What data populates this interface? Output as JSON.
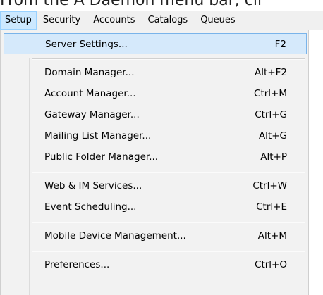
{
  "caption": "From the A Daemon menu bar, cli",
  "menubar": {
    "items": [
      "Setup",
      "Security",
      "Accounts",
      "Catalogs",
      "Queues"
    ]
  },
  "menu": {
    "items": [
      {
        "label": "Server Settings...",
        "shortcut": "F2"
      },
      {
        "label": "Domain Manager...",
        "shortcut": "Alt+F2"
      },
      {
        "label": "Account Manager...",
        "shortcut": "Ctrl+M"
      },
      {
        "label": "Gateway Manager...",
        "shortcut": "Ctrl+G"
      },
      {
        "label": "Mailing List Manager...",
        "shortcut": "Alt+G"
      },
      {
        "label": "Public Folder Manager...",
        "shortcut": "Alt+P"
      },
      {
        "label": "Web & IM Services...",
        "shortcut": "Ctrl+W"
      },
      {
        "label": "Event Scheduling...",
        "shortcut": "Ctrl+E"
      },
      {
        "label": "Mobile Device Management...",
        "shortcut": "Alt+M"
      },
      {
        "label": "Preferences...",
        "shortcut": "Ctrl+O"
      }
    ]
  }
}
